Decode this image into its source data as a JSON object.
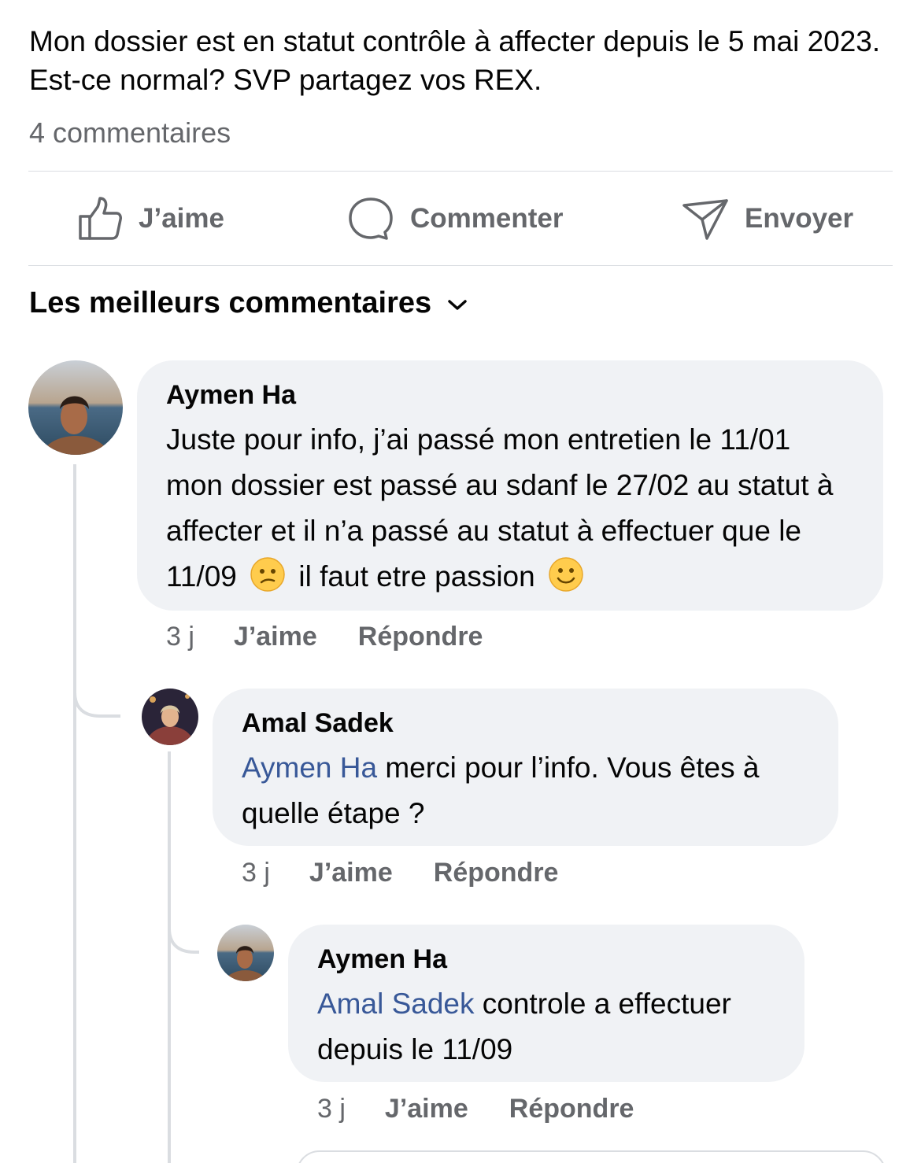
{
  "post": {
    "text": "Mon dossier est en statut contrôle à affecter depuis le 5 mai 2023. Est-ce normal? SVP partagez vos REX.",
    "comment_count": "4 commentaires"
  },
  "actions": {
    "like": "J’aime",
    "comment": "Commenter",
    "send": "Envoyer"
  },
  "sort": {
    "label": "Les meilleurs commentaires"
  },
  "comments": [
    {
      "author": "Aymen Ha",
      "text_part1": "Juste pour info, j’ai passé mon entretien le 11/01 mon dossier est passé au sdanf le 27/02 au statut à affecter et il n’a passé au statut à effectuer que le 11/09",
      "text_part2": "il faut etre passion",
      "time": "3 j",
      "like": "J’aime",
      "reply": "Répondre"
    },
    {
      "author": "Amal Sadek",
      "mention": "Aymen Ha",
      "text": " merci pour l’info. Vous êtes à quelle étape ?",
      "time": "3 j",
      "like": "J’aime",
      "reply": "Répondre"
    },
    {
      "author": "Aymen Ha",
      "mention": "Amal Sadek",
      "text": " controle a effectuer depuis le 11/09",
      "time": "3 j",
      "like": "J’aime",
      "reply": "Répondre"
    }
  ],
  "colors": {
    "bubble": "#f0f2f5",
    "secondary_text": "#65676b",
    "mention": "#385898"
  }
}
